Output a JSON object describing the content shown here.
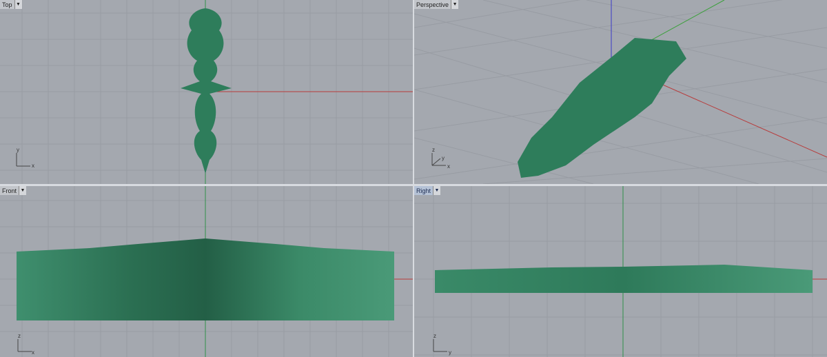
{
  "viewports": [
    {
      "name": "Top",
      "active": false,
      "axes": [
        "y",
        "x"
      ]
    },
    {
      "name": "Perspective",
      "active": false,
      "axes": [
        "z",
        "y",
        "x"
      ]
    },
    {
      "name": "Front",
      "active": false,
      "axes": [
        "z",
        "x"
      ]
    },
    {
      "name": "Right",
      "active": true,
      "axes": [
        "z",
        "y"
      ]
    }
  ],
  "icons": {
    "menu": "triangle-down-icon"
  },
  "colors": {
    "background": "#a4a8af",
    "grid": "#979ba2",
    "x_axis": "#b83a3a",
    "y_axis": "#3aa03a",
    "z_axis": "#3a3ac8",
    "model": "#2e7d5b"
  }
}
